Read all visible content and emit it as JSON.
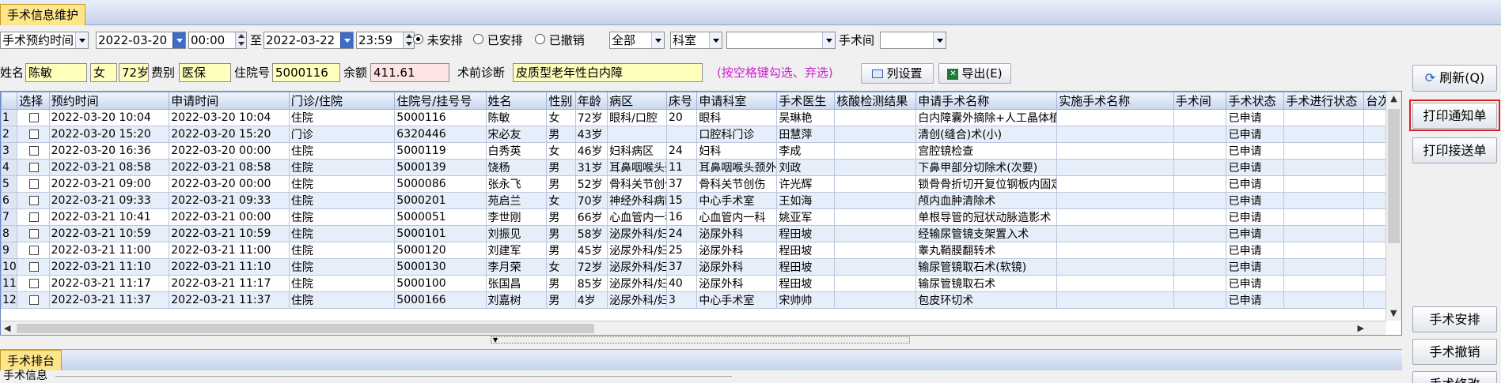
{
  "window": {
    "tab_title": "手术信息维护"
  },
  "filters": {
    "time_type": "手术预约时间",
    "date_from": "2022-03-20",
    "time_from": "00:00",
    "to_label": "至",
    "date_to": "2022-03-22",
    "time_to": "23:59",
    "radios": [
      {
        "label": "未安排",
        "checked": true
      },
      {
        "label": "已安排",
        "checked": false
      },
      {
        "label": "已撤销",
        "checked": false
      }
    ],
    "scope": "全部",
    "dept_label": "科室",
    "dept_value": "",
    "room_label": "手术间",
    "room_value": ""
  },
  "patient": {
    "name_label": "姓名",
    "name": "陈敏",
    "sex": "女",
    "age": "72岁",
    "fee_label": "费别",
    "fee": "医保",
    "inpatient_label": "住院号",
    "inpatient_no": "5000116",
    "balance_label": "余额",
    "balance": "411.61",
    "diag_label": "术前诊断",
    "diagnosis": "皮质型老年性白内障",
    "hint": "(按空格键勾选、弃选)",
    "col_setting_btn": "列设置",
    "export_btn": "导出(E)"
  },
  "side_buttons": {
    "refresh": "刷新(Q)",
    "print_notice": "打印通知单",
    "print_transfer": "打印接送单",
    "arrange": "手术安排",
    "cancel": "手术撤销",
    "partial": "手术修改"
  },
  "table": {
    "headers": [
      "",
      "选择",
      "预约时间",
      "申请时间",
      "门诊/住院",
      "住院号/挂号号",
      "姓名",
      "性别",
      "年龄",
      "病区",
      "床号",
      "申请科室",
      "手术医生",
      "核酸检测结果",
      "申请手术名称",
      "实施手术名称",
      "手术间",
      "手术状态",
      "手术进行状态",
      "台次"
    ],
    "rows": [
      [
        "1",
        "",
        "2022-03-20 10:04",
        "2022-03-20 10:04",
        "住院",
        "5000116",
        "陈敏",
        "女",
        "72岁",
        "眼科/口腔",
        "20",
        "眼科",
        "吴琳艳",
        "",
        "白内障囊外摘除+人工晶体植入术",
        "",
        "",
        "已申请",
        "",
        ""
      ],
      [
        "2",
        "",
        "2022-03-20 15:20",
        "2022-03-20 15:20",
        "门诊",
        "6320446",
        "宋必友",
        "男",
        "43岁",
        "",
        "",
        "口腔科门诊",
        "田慧萍",
        "",
        "清创(缝合)术(小)",
        "",
        "",
        "已申请",
        "",
        ""
      ],
      [
        "3",
        "",
        "2022-03-20 16:36",
        "2022-03-20 00:00",
        "住院",
        "5000119",
        "白秀英",
        "女",
        "46岁",
        "妇科病区",
        "24",
        "妇科",
        "李成",
        "",
        "宫腔镜检查",
        "",
        "",
        "已申请",
        "",
        ""
      ],
      [
        "4",
        "",
        "2022-03-21 08:58",
        "2022-03-21 08:58",
        "住院",
        "5000139",
        "饶杨",
        "男",
        "31岁",
        "耳鼻咽喉头颈外科",
        "11",
        "耳鼻咽喉头颈外科",
        "刘政",
        "",
        "下鼻甲部分切除术(次要)",
        "",
        "",
        "已申请",
        "",
        ""
      ],
      [
        "5",
        "",
        "2022-03-21 09:00",
        "2022-03-20 00:00",
        "住院",
        "5000086",
        "张永飞",
        "男",
        "52岁",
        "骨科关节创伤",
        "37",
        "骨科关节创伤",
        "许光辉",
        "",
        "锁骨骨折切开复位钢板内固定术",
        "",
        "",
        "已申请",
        "",
        ""
      ],
      [
        "6",
        "",
        "2022-03-21 09:33",
        "2022-03-21 09:33",
        "住院",
        "5000201",
        "苑启兰",
        "女",
        "70岁",
        "神经外科病区",
        "15",
        "中心手术室",
        "王如海",
        "",
        "颅内血肿清除术",
        "",
        "",
        "已申请",
        "",
        ""
      ],
      [
        "7",
        "",
        "2022-03-21 10:41",
        "2022-03-21 00:00",
        "住院",
        "5000051",
        "李世刚",
        "男",
        "66岁",
        "心血管内一科",
        "16",
        "心血管内一科",
        "姚亚军",
        "",
        "单根导管的冠状动脉造影术",
        "",
        "",
        "已申请",
        "",
        ""
      ],
      [
        "8",
        "",
        "2022-03-21 10:59",
        "2022-03-21 10:59",
        "住院",
        "5000101",
        "刘振见",
        "男",
        "58岁",
        "泌尿外科/妇科",
        "24",
        "泌尿外科",
        "程田坡",
        "",
        "经输尿管镜支架置入术",
        "",
        "",
        "已申请",
        "",
        ""
      ],
      [
        "9",
        "",
        "2022-03-21 11:00",
        "2022-03-21 11:00",
        "住院",
        "5000120",
        "刘建军",
        "男",
        "45岁",
        "泌尿外科/妇科",
        "25",
        "泌尿外科",
        "程田坡",
        "",
        "睾丸鞘膜翻转术",
        "",
        "",
        "已申请",
        "",
        ""
      ],
      [
        "10",
        "",
        "2022-03-21 11:10",
        "2022-03-21 11:10",
        "住院",
        "5000130",
        "李月荣",
        "女",
        "72岁",
        "泌尿外科/妇科",
        "37",
        "泌尿外科",
        "程田坡",
        "",
        "输尿管镜取石术(软镜)",
        "",
        "",
        "已申请",
        "",
        ""
      ],
      [
        "11",
        "",
        "2022-03-21 11:17",
        "2022-03-21 11:17",
        "住院",
        "5000100",
        "张国昌",
        "男",
        "85岁",
        "泌尿外科/妇科",
        "40",
        "泌尿外科",
        "程田坡",
        "",
        "输尿管镜取石术",
        "",
        "",
        "已申请",
        "",
        ""
      ],
      [
        "12",
        "",
        "2022-03-21 11:37",
        "2022-03-21 11:37",
        "住院",
        "5000166",
        "刘嘉树",
        "男",
        "4岁",
        "泌尿外科/妇科",
        "3",
        "中心手术室",
        "宋帅帅",
        "",
        "包皮环切术",
        "",
        "",
        "已申请",
        "",
        ""
      ]
    ]
  },
  "bottom": {
    "tab": "手术排台",
    "section": "手术信息"
  }
}
